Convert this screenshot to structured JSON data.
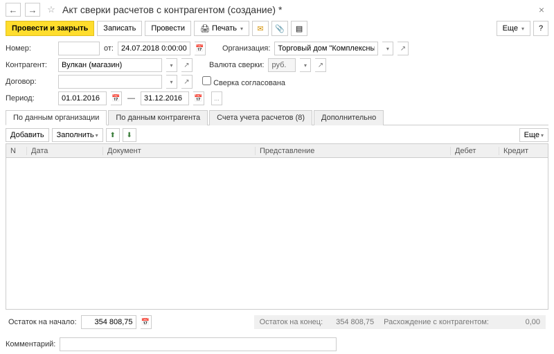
{
  "title": "Акт сверки расчетов с контрагентом (создание) *",
  "nav": {
    "back": "←",
    "fwd": "→",
    "star": "☆",
    "close": "×"
  },
  "toolbar": {
    "post_close": "Провести и закрыть",
    "save": "Записать",
    "post": "Провести",
    "print": "Печать",
    "more": "Еще",
    "help": "?"
  },
  "labels": {
    "number": "Номер:",
    "from": "от:",
    "org": "Организация:",
    "counterparty": "Контрагент:",
    "currency": "Валюта сверки:",
    "contract": "Договор:",
    "agreed": "Сверка согласована",
    "period": "Период:"
  },
  "fields": {
    "number": "",
    "date": "24.07.2018 0:00:00",
    "org": "Торговый дом \"Комплексный\" ООО",
    "counterparty": "Вулкан (магазин)",
    "currency": "руб.",
    "contract": "",
    "period_from": "01.01.2016",
    "period_to": "31.12.2016"
  },
  "tabs": [
    "По данным организации",
    "По данным контрагента",
    "Счета учета расчетов (8)",
    "Дополнительно"
  ],
  "active_tab": 0,
  "table": {
    "toolbar": {
      "add": "Добавить",
      "fill": "Заполнить",
      "more": "Еще"
    },
    "columns": {
      "n": "N",
      "date": "Дата",
      "doc": "Документ",
      "rep": "Представление",
      "deb": "Дебет",
      "cre": "Кредит"
    }
  },
  "footer": {
    "start_lbl": "Остаток на начало:",
    "start_val": "354 808,75",
    "end_lbl": "Остаток на конец:",
    "end_val": "354 808,75",
    "diff_lbl": "Расхождение с контрагентом:",
    "diff_val": "0,00"
  },
  "comment_lbl": "Комментарий:",
  "comment_val": ""
}
